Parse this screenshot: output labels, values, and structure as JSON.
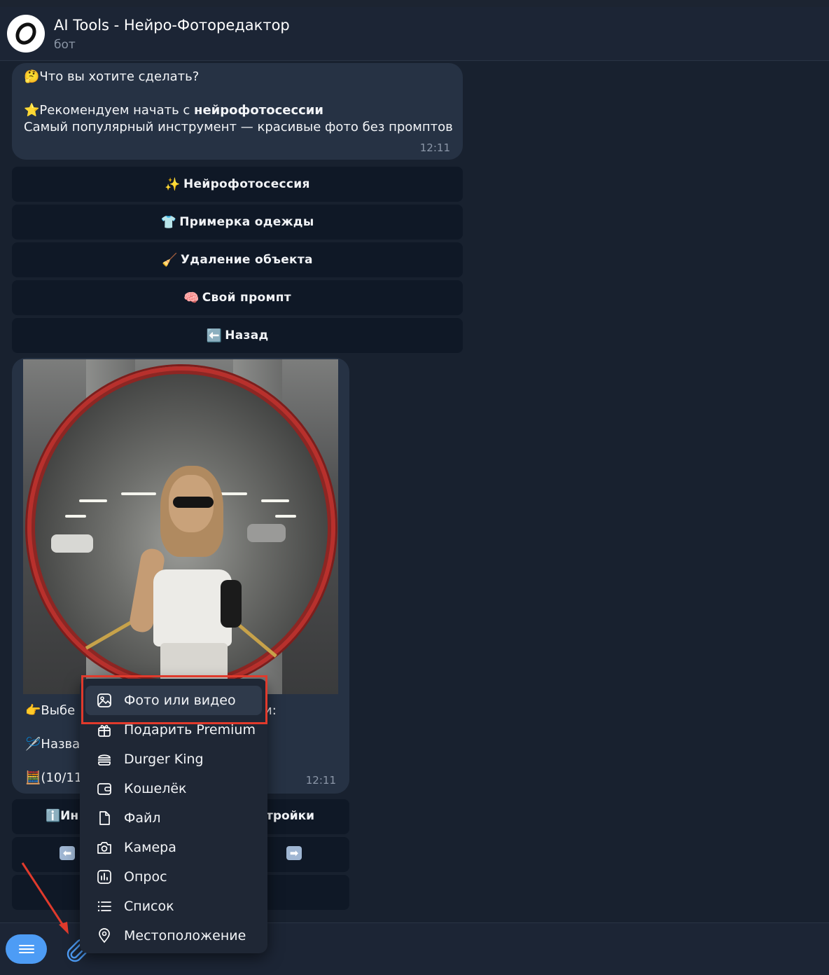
{
  "header": {
    "title": "AI Tools - Нейро-Фоторедактор",
    "subtitle": "бот"
  },
  "message": {
    "line1_emoji": "🤔",
    "line1": "Что вы хотите сделать?",
    "line2_emoji": "⭐",
    "line2_prefix": "Рекомендуем начать с ",
    "line2_bold": "нейрофотосессии",
    "line3": "Самый популярный инструмент — красивые фото без промптов",
    "time": "12:11"
  },
  "keyboard": [
    {
      "emoji": "✨",
      "label": "Нейрофотосессия"
    },
    {
      "emoji": "👕",
      "label": "Примерка одежды"
    },
    {
      "emoji": "🧹",
      "label": "Удаление объекта"
    },
    {
      "emoji": "🧠",
      "label": "Свой промпт"
    },
    {
      "emoji": "⬅️",
      "label": "Назад"
    }
  ],
  "photo_message": {
    "caption1_emoji": "👉",
    "caption1_left": "Выбе",
    "caption1_right": "и:",
    "caption2_emoji": "🪡",
    "caption2_left": "Назва",
    "caption3_emoji": "🧮",
    "caption3_left": "(10/11",
    "time": "12:11"
  },
  "keyboard2": {
    "row1_left_emoji": "ℹ️",
    "row1_left": "Ин",
    "row1_right": "тройки",
    "prev_arrow": "⬅",
    "next_arrow": "➡"
  },
  "attach_menu": {
    "items": [
      {
        "label": "Фото или видео",
        "icon": "photo-icon"
      },
      {
        "label": "Подарить Premium",
        "icon": "gift-icon"
      },
      {
        "label": "Durger King",
        "icon": "burger-icon"
      },
      {
        "label": "Кошелёк",
        "icon": "wallet-icon"
      },
      {
        "label": "Файл",
        "icon": "file-icon"
      },
      {
        "label": "Камера",
        "icon": "camera-icon"
      },
      {
        "label": "Опрос",
        "icon": "poll-icon"
      },
      {
        "label": "Список",
        "icon": "list-icon"
      },
      {
        "label": "Местоположение",
        "icon": "location-icon"
      }
    ]
  },
  "colors": {
    "background": "#18212f",
    "bubble": "#263244",
    "keyboard_button": "#0f1826",
    "accent": "#4d9cf5",
    "highlight": "#e03a2c"
  }
}
